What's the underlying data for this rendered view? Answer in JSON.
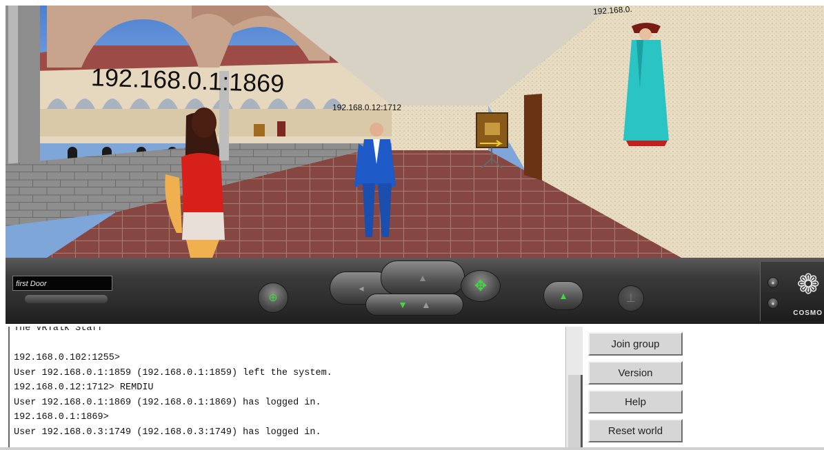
{
  "viewport": {
    "labels": {
      "main": "192.168.0.1:1869",
      "center": "192.168.0.12:1712",
      "top_right": "192.168.0."
    }
  },
  "controls": {
    "viewpoint": "first Door",
    "logo_text": "COSMO",
    "accent_color": "#3fd63f"
  },
  "chat": {
    "lines": [
      "The VRTalk Staff",
      "",
      "192.168.0.102:1255>",
      "User 192.168.0.1:1859 (192.168.0.1:1859) left the system.",
      "192.168.0.12:1712> REMDIU",
      "User 192.168.0.1:1869 (192.168.0.1:1869) has logged in.",
      "192.168.0.1:1869>",
      "User 192.168.0.3:1749 (192.168.0.3:1749) has logged in."
    ]
  },
  "buttons": {
    "join_group": "Join group",
    "version": "Version",
    "help": "Help",
    "reset_world": "Reset world"
  }
}
